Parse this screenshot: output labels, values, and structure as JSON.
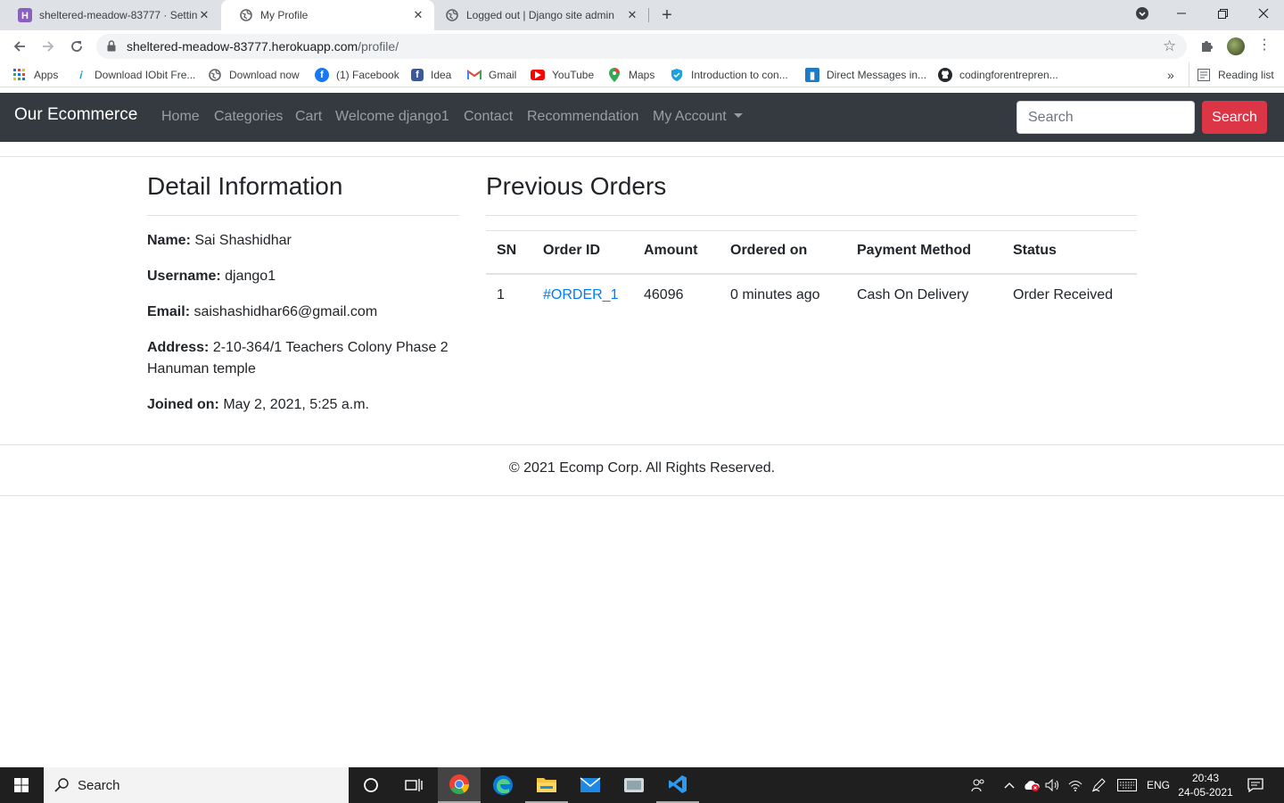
{
  "browser": {
    "tabs": [
      {
        "title": "sheltered-meadow-83777 · Settin",
        "active": false
      },
      {
        "title": "My Profile",
        "active": true
      },
      {
        "title": "Logged out | Django site admin",
        "active": false
      }
    ],
    "url_host": "sheltered-meadow-83777.herokuapp.com",
    "url_path": "/profile/",
    "bookmarks": [
      {
        "label": "Apps",
        "icon": "apps-grid-icon"
      },
      {
        "label": "Download IObit Fre...",
        "icon": "iobit-icon"
      },
      {
        "label": "Download now",
        "icon": "globe-icon"
      },
      {
        "label": "(1) Facebook",
        "icon": "facebook-icon"
      },
      {
        "label": "Idea",
        "icon": "facebook-icon"
      },
      {
        "label": "Gmail",
        "icon": "gmail-icon"
      },
      {
        "label": "YouTube",
        "icon": "youtube-icon"
      },
      {
        "label": "Maps",
        "icon": "maps-icon"
      },
      {
        "label": "Introduction to con...",
        "icon": "shield-icon"
      },
      {
        "label": "Direct Messages in...",
        "icon": "bookmark-icon"
      },
      {
        "label": "codingforentrepren...",
        "icon": "github-icon"
      }
    ],
    "bookmarks_more": "»",
    "reading_list": "Reading list"
  },
  "site": {
    "brand": "Our Ecommerce",
    "nav": [
      "Home",
      "Categories",
      "Cart",
      "Welcome django1",
      "Contact",
      "Recommendation",
      "My Account"
    ],
    "search_placeholder": "Search",
    "search_button": "Search"
  },
  "profile": {
    "heading": "Detail Information",
    "fields": [
      {
        "label": "Name:",
        "value": "Sai Shashidhar"
      },
      {
        "label": "Username:",
        "value": "django1"
      },
      {
        "label": "Email:",
        "value": "saishashidhar66@gmail.com"
      },
      {
        "label": "Address:",
        "value": "2-10-364/1 Teachers Colony Phase 2 Hanuman temple"
      },
      {
        "label": "Joined on:",
        "value": "May 2, 2021, 5:25 a.m."
      }
    ]
  },
  "orders": {
    "heading": "Previous Orders",
    "columns": [
      "SN",
      "Order ID",
      "Amount",
      "Ordered on",
      "Payment Method",
      "Status"
    ],
    "rows": [
      {
        "sn": "1",
        "order_id": "#ORDER_1",
        "amount": "46096",
        "ordered_on": "0 minutes ago",
        "payment_method": "Cash On Delivery",
        "status": "Order Received"
      }
    ]
  },
  "footer": {
    "text": "© 2021 Ecomp Corp. All Rights Reserved."
  },
  "taskbar": {
    "search_label": "Search",
    "language": "ENG",
    "time": "20:43",
    "date": "24-05-2021"
  },
  "colors": {
    "navbar": "#343a40",
    "danger": "#dc3545",
    "link": "#007bff"
  }
}
